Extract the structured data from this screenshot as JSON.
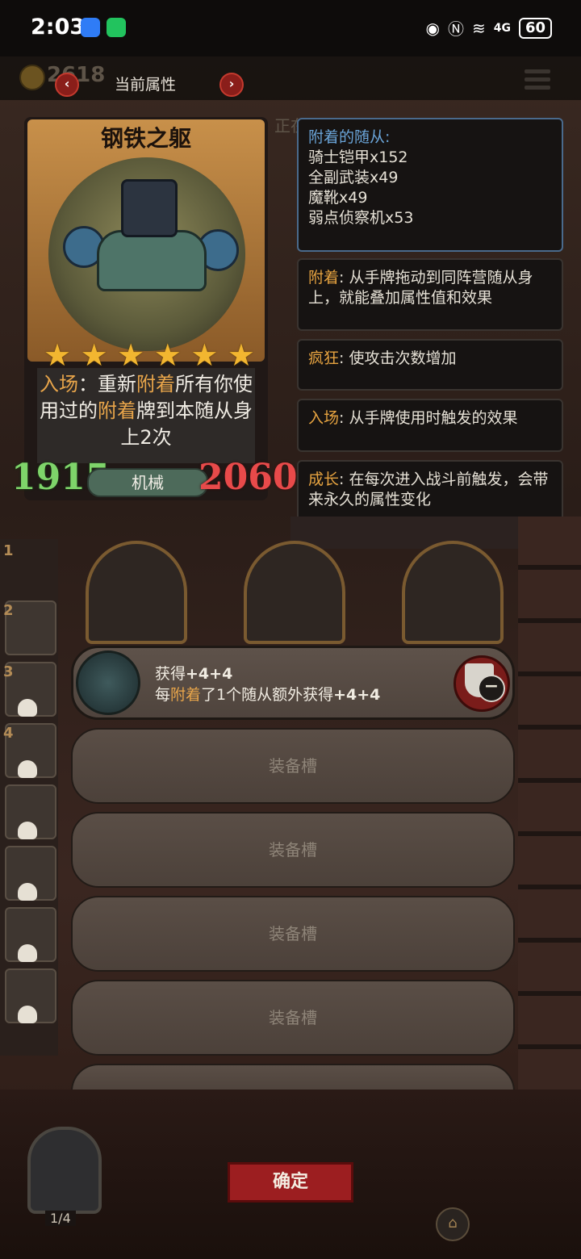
{
  "status_bar": {
    "time": "2:03",
    "battery": "60",
    "network": "4G"
  },
  "header": {
    "coins": "2618",
    "title": "当前属性",
    "prev_label": "‹",
    "next_label": "›",
    "behind_text": "正在"
  },
  "card": {
    "name": "钢铁之躯",
    "stars": 6,
    "desc_pre1": "入场",
    "desc_mid1": "：重新",
    "desc_hl2": "附着",
    "desc_mid2": "所有你使用过的",
    "desc_hl3": "附着",
    "desc_end": "牌到本随从身上2次",
    "attack": "1915",
    "health": "2060",
    "tribe": "机械"
  },
  "attached": {
    "title": "附着的随从:",
    "items": [
      "骑士铠甲x152",
      "全副武装x49",
      "魔靴x49",
      "弱点侦察机x53"
    ]
  },
  "keywords": [
    {
      "name": "附着",
      "desc": ": 从手牌拖动到同阵营随从身上，就能叠加属性值和效果"
    },
    {
      "name": "疯狂",
      "desc": ": 使攻击次数增加"
    },
    {
      "name": "入场",
      "desc": ": 从手牌使用时触发的效果"
    },
    {
      "name": "成长",
      "desc": ": 在每次进入战斗前触发，会带来永久的属性变化"
    }
  ],
  "side_slots": [
    "1",
    "2",
    "3",
    "4"
  ],
  "equip_active": {
    "line1_pre": "获得",
    "line1_val": "+4+4",
    "line2_pre": "每",
    "line2_hl": "附着",
    "line2_post": "了1个随从额外获得",
    "line2_val": "+4+4"
  },
  "equip_slots": [
    "装备槽",
    "装备槽",
    "装备槽",
    "装备槽"
  ],
  "confirm_label": "确定",
  "deck_count": "1/4"
}
